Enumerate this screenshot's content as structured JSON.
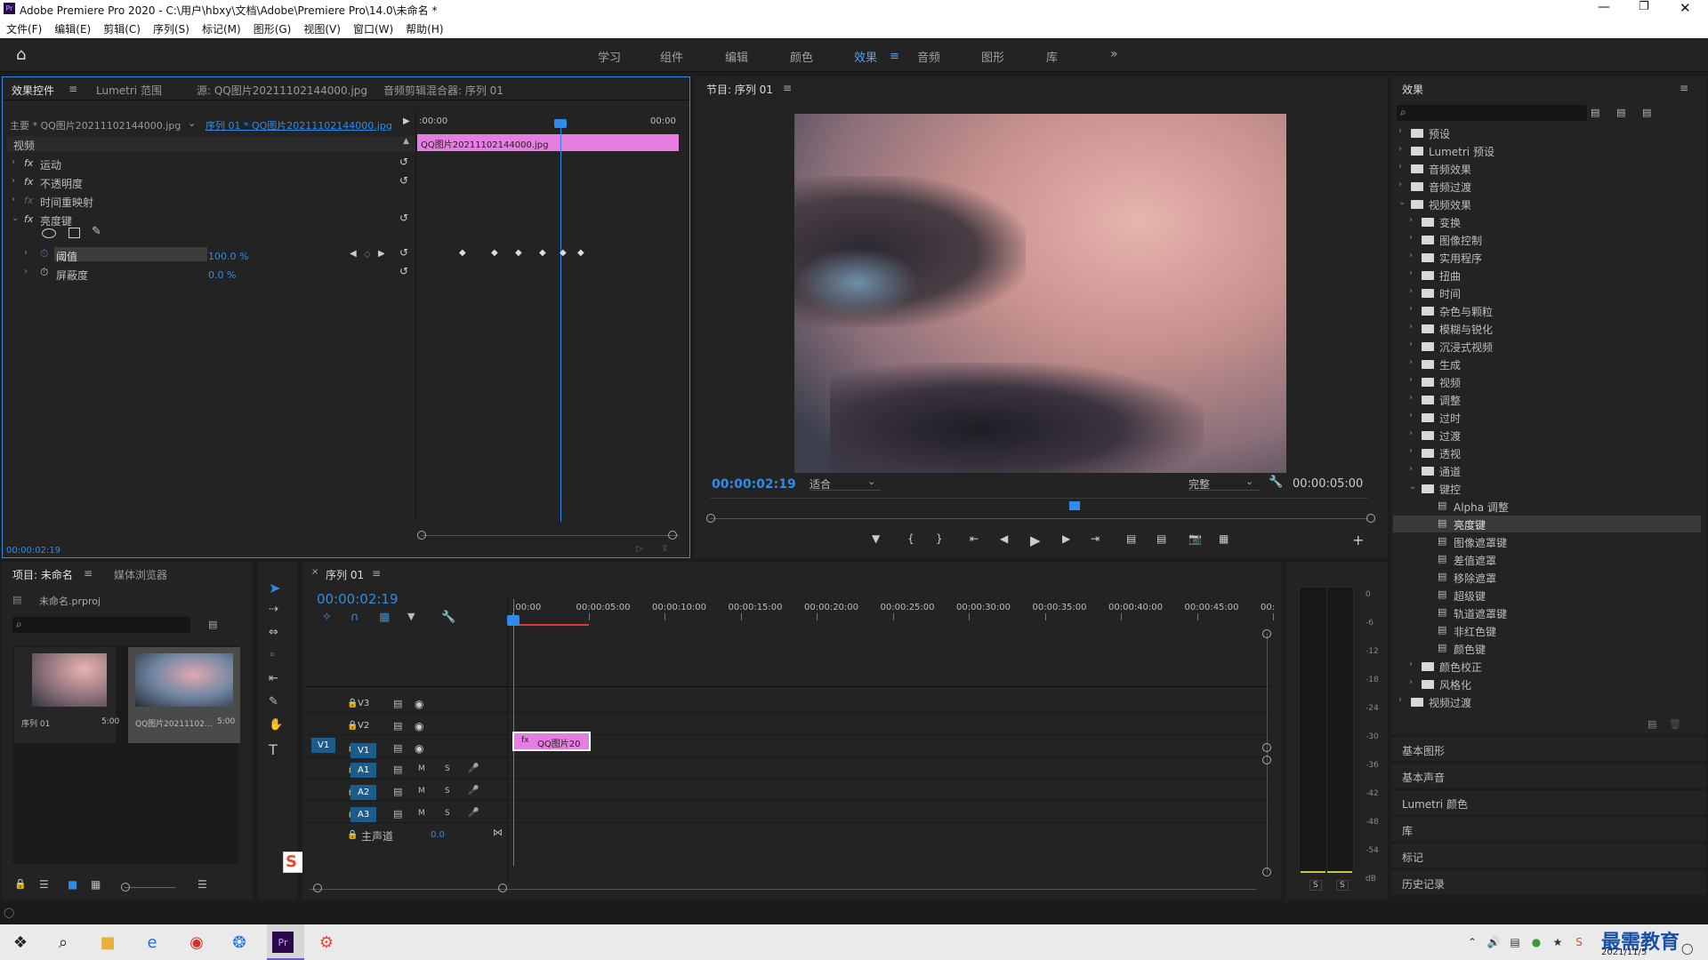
{
  "window": {
    "title": "Adobe Premiere Pro 2020 - C:\\用户\\hbxy\\文档\\Adobe\\Premiere Pro\\14.0\\未命名 *"
  },
  "menu": [
    "文件(F)",
    "编辑(E)",
    "剪辑(C)",
    "序列(S)",
    "标记(M)",
    "图形(G)",
    "视图(V)",
    "窗口(W)",
    "帮助(H)"
  ],
  "workspaces": [
    "学习",
    "组件",
    "编辑",
    "颜色",
    "效果",
    "音频",
    "图形",
    "库"
  ],
  "effect_controls": {
    "tabs": [
      "效果控件",
      "Lumetri 范围",
      "源: QQ图片20211102144000.jpg",
      "音频剪辑混合器: 序列 01"
    ],
    "master": "主要 * QQ图片20211102144000.jpg",
    "seq": "序列 01 * QQ图片20211102144000.jpg",
    "tc_start": ":00:00",
    "tc_end": "00:00",
    "clip": "QQ图片20211102144000.jpg",
    "section": "视频",
    "fx": [
      "运动",
      "不透明度",
      "时间重映射",
      "亮度键"
    ],
    "params": [
      {
        "name": "阈值",
        "value": "100.0 %"
      },
      {
        "name": "屏蔽度",
        "value": "0.0 %"
      }
    ],
    "timecode": "00:00:02:19"
  },
  "program": {
    "title": "节目: 序列 01",
    "timecode": "00:00:02:19",
    "fit": "适合",
    "quality": "完整",
    "duration": "00:00:05:00"
  },
  "effects_panel": {
    "title": "效果",
    "tree": [
      {
        "label": "预设",
        "level": 0
      },
      {
        "label": "Lumetri 预设",
        "level": 0
      },
      {
        "label": "音频效果",
        "level": 0
      },
      {
        "label": "音频过渡",
        "level": 0
      },
      {
        "label": "视频效果",
        "level": 0,
        "open": true
      },
      {
        "label": "变换",
        "level": 1
      },
      {
        "label": "图像控制",
        "level": 1
      },
      {
        "label": "实用程序",
        "level": 1
      },
      {
        "label": "扭曲",
        "level": 1
      },
      {
        "label": "时间",
        "level": 1
      },
      {
        "label": "杂色与颗粒",
        "level": 1
      },
      {
        "label": "模糊与锐化",
        "level": 1
      },
      {
        "label": "沉浸式视频",
        "level": 1
      },
      {
        "label": "生成",
        "level": 1
      },
      {
        "label": "视频",
        "level": 1
      },
      {
        "label": "调整",
        "level": 1
      },
      {
        "label": "过时",
        "level": 1
      },
      {
        "label": "过渡",
        "level": 1
      },
      {
        "label": "透视",
        "level": 1
      },
      {
        "label": "通道",
        "level": 1
      },
      {
        "label": "键控",
        "level": 1,
        "open": true
      },
      {
        "label": "Alpha 调整",
        "level": 2
      },
      {
        "label": "亮度键",
        "level": 2,
        "selected": true
      },
      {
        "label": "图像遮罩键",
        "level": 2
      },
      {
        "label": "差值遮罩",
        "level": 2
      },
      {
        "label": "移除遮罩",
        "level": 2
      },
      {
        "label": "超级键",
        "level": 2
      },
      {
        "label": "轨道遮罩键",
        "level": 2
      },
      {
        "label": "非红色键",
        "level": 2
      },
      {
        "label": "颜色键",
        "level": 2
      },
      {
        "label": "颜色校正",
        "level": 1
      },
      {
        "label": "风格化",
        "level": 1
      },
      {
        "label": "视频过渡",
        "level": 0
      }
    ],
    "bottom": [
      "基本图形",
      "基本声音",
      "Lumetri 颜色",
      "库",
      "标记",
      "历史记录"
    ]
  },
  "project": {
    "tabs": [
      "项目: 未命名",
      "媒体浏览器"
    ],
    "file": "未命名.prproj",
    "items": [
      {
        "name": "序列 01",
        "dur": "5:00"
      },
      {
        "name": "QQ图片20211102...",
        "dur": "5:00"
      }
    ]
  },
  "timeline": {
    "tab": "序列 01",
    "timecode": "00:00:02:19",
    "ruler": [
      ":00:00",
      "00:00:05:00",
      "00:00:10:00",
      "00:00:15:00",
      "00:00:20:00",
      "00:00:25:00",
      "00:00:30:00",
      "00:00:35:00",
      "00:00:40:00",
      "00:00:45:00",
      "00:"
    ],
    "video_tracks": [
      "V3",
      "V2",
      "V1"
    ],
    "audio_tracks": [
      "A1",
      "A2",
      "A3"
    ],
    "src_patch": "V1",
    "master": "主声道",
    "master_val": "0.0",
    "clip": "QQ图片20"
  },
  "meter": {
    "scale": [
      "0",
      "-6",
      "-12",
      "-18",
      "-24",
      "-30",
      "-36",
      "-42",
      "-48",
      "-54",
      "dB"
    ]
  },
  "taskbar": {
    "date": "2021/11/5",
    "watermark": "最需教育"
  }
}
